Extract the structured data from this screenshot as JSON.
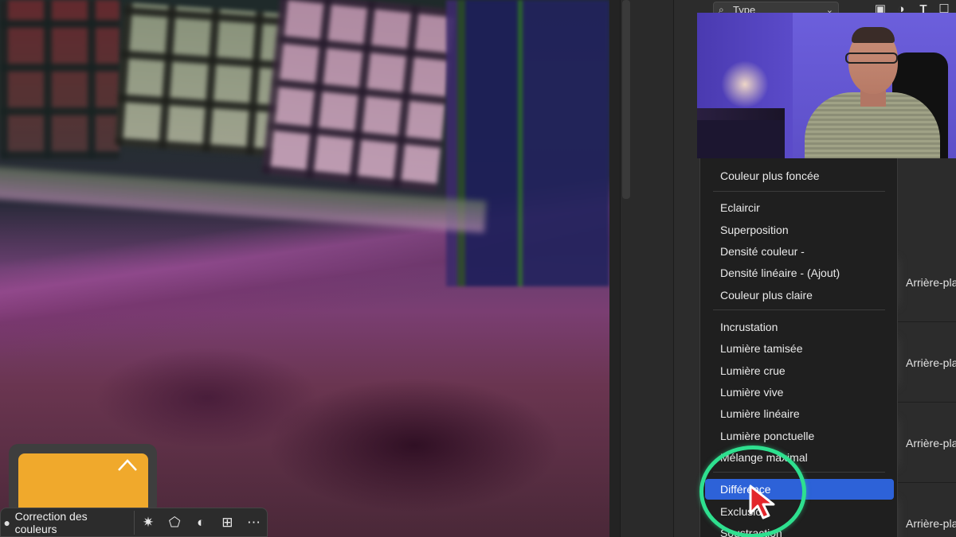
{
  "layers_panel": {
    "filter_label": "Type",
    "filter_icon": "search-icon",
    "tool_icons": [
      "image-filter-icon",
      "adjustment-filter-icon",
      "type-filter-icon",
      "shape-filter-icon"
    ],
    "layer_names": [
      "Arrière-pla",
      "Arrière-pla",
      "Arrière-pla",
      "Arrière-pla"
    ]
  },
  "blend_menu": {
    "top_cut_item": "Couleur plus foncée",
    "groups": [
      [
        "Couleur plus foncée"
      ],
      [
        "Eclaircir",
        "Superposition",
        "Densité couleur -",
        "Densité linéaire - (Ajout)",
        "Couleur plus claire"
      ],
      [
        "Incrustation",
        "Lumière tamisée",
        "Lumière crue",
        "Lumière vive",
        "Lumière linéaire",
        "Lumière ponctuelle",
        "Mélange maximal"
      ],
      [
        "Différence",
        "Exclusion",
        "Soustraction"
      ]
    ],
    "selected": "Différence",
    "highlight_color": "#2d62d8",
    "ring_color": "#2ee08f"
  },
  "contextual_taskbar": {
    "color_correction_label": "Correction des couleurs",
    "icons": [
      "sparkle-select-icon",
      "transform-icon",
      "adjust-icon",
      "add-layer-icon",
      "more-icon"
    ]
  },
  "accent": {
    "orange": "#f0a92c"
  }
}
